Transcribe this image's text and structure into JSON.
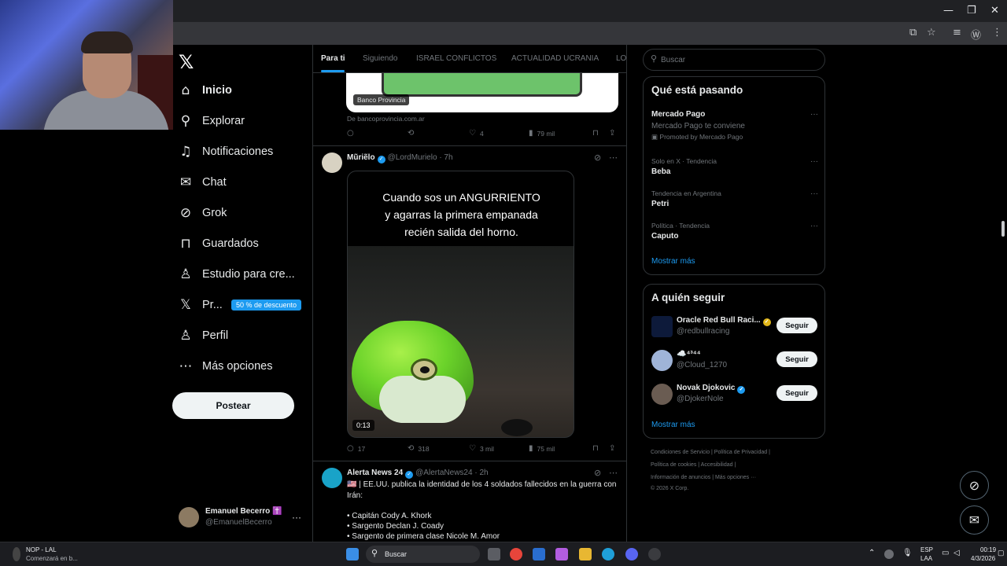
{
  "window": {
    "minimize": "—",
    "restore": "❐",
    "close": "✕"
  },
  "nav": {
    "logo": "𝕏",
    "items": [
      {
        "label": "Inicio",
        "icon": "home-icon",
        "glyph": "⌂"
      },
      {
        "label": "Explorar",
        "icon": "search-icon",
        "glyph": "⚲"
      },
      {
        "label": "Notificaciones",
        "icon": "bell-icon",
        "glyph": "♫"
      },
      {
        "label": "Chat",
        "icon": "mail-icon",
        "glyph": "✉"
      },
      {
        "label": "Grok",
        "icon": "grok-icon",
        "glyph": "⊘"
      },
      {
        "label": "Guardados",
        "icon": "bookmark-icon",
        "glyph": "⊓"
      },
      {
        "label": "Estudio para cre...",
        "icon": "studio-icon",
        "glyph": "♙"
      },
      {
        "label": "Pr...",
        "icon": "x-premium-icon",
        "glyph": "𝕏"
      },
      {
        "label": "Perfil",
        "icon": "profile-icon",
        "glyph": "♙"
      },
      {
        "label": "Más opciones",
        "icon": "more-options-icon",
        "glyph": "⋯"
      }
    ],
    "promo_badge": "50 % de descuento",
    "post_button": "Postear",
    "account": {
      "name": "Emanuel Becerro ✝️",
      "handle": "@EmanuelBecerro",
      "more": "···"
    }
  },
  "feed": {
    "tabs": [
      "Para ti",
      "Siguiendo",
      "ISRAEL CONFLICTOS",
      "ACTUALIDAD UCRANIA",
      "LO"
    ],
    "card": {
      "tag": "Banco Provincia",
      "source": "De bancoprovincia.com.ar",
      "replies": "",
      "reposts": "",
      "likes": "4",
      "views": "79 mil"
    },
    "tweet1": {
      "name": "Mũriẽlo",
      "handle": "@LordMurielo",
      "time": "· 7h",
      "caption_lines": [
        "Cuando sos un ANGURRIENTO",
        "y agarras la primera empanada",
        "recién salida del horno."
      ],
      "duration": "0:13",
      "replies": "17",
      "reposts": "318",
      "likes": "3 mil",
      "views": "75 mil"
    },
    "tweet2": {
      "name": "Alerta News 24",
      "handle": "@AlertaNews24",
      "time": "· 2h",
      "text_line1": "🇺🇸 | EE.UU. publica la identidad de los 4 soldados fallecidos en la guerra con Irán:",
      "list": [
        "• Capitán Cody A. Khork",
        "• Sargento Declan J. Coady",
        "• Sargento de primera clase Nicole M. Amor"
      ]
    }
  },
  "right": {
    "search_placeholder": "Buscar",
    "trends": {
      "title": "Qué está pasando",
      "promoted": {
        "name": "Mercado Pago",
        "desc": "Mercado Pago te conviene",
        "label": "Promoted by Mercado Pago"
      },
      "items": [
        {
          "context": "Solo en X · Tendencia",
          "name": "Beba"
        },
        {
          "context": "Tendencia en Argentina",
          "name": "Petri"
        },
        {
          "context": "Política · Tendencia",
          "name": "Caputo"
        }
      ],
      "show_more": "Mostrar más"
    },
    "who_to_follow": {
      "title": "A quién seguir",
      "accounts": [
        {
          "name": "Oracle Red Bull Raci...",
          "handle": "@redbullracing"
        },
        {
          "name": "☁️⁴³⁴⁴",
          "handle": "@Cloud_1270"
        },
        {
          "name": "Novak Djokovic",
          "handle": "@DjokerNole"
        }
      ],
      "follow_label": "Seguir",
      "show_more": "Mostrar más"
    },
    "footer": {
      "line1": "Condiciones de Servicio  |  Política de Privacidad  |",
      "line2": "Política de cookies  |  Accesibilidad  |",
      "line3": "Información de anuncios  |  Más opciones ···",
      "line4": "© 2026 X Corp."
    }
  },
  "taskbar": {
    "media_title": "NOP - LAL",
    "media_sub": "Comenzará en b...",
    "search": "Buscar",
    "lang1": "ESP",
    "lang2": "LAA",
    "time": "00:19",
    "date": "4/3/2026"
  },
  "colors": {
    "accent": "#1d9bf0",
    "background": "#000000",
    "border": "#2f3336"
  }
}
